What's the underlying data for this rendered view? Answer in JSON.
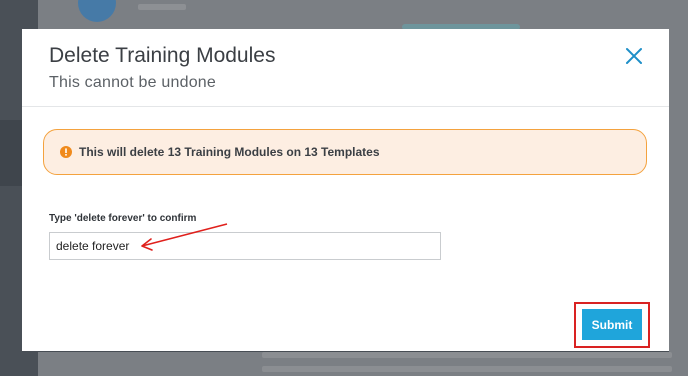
{
  "modal": {
    "title": "Delete Training Modules",
    "subtitle": "This cannot be undone",
    "close_icon": "close-icon"
  },
  "alert": {
    "icon": "warning-icon",
    "text": "This will delete 13 Training Modules on 13 Templates",
    "bg_color": "#fdeee2",
    "border_color": "#f4a23e"
  },
  "confirm": {
    "label": "Type 'delete forever' to confirm",
    "value": "delete forever"
  },
  "footer": {
    "submit_label": "Submit",
    "submit_color": "#1fa5db"
  },
  "annotations": {
    "highlight_color": "#d92222"
  }
}
